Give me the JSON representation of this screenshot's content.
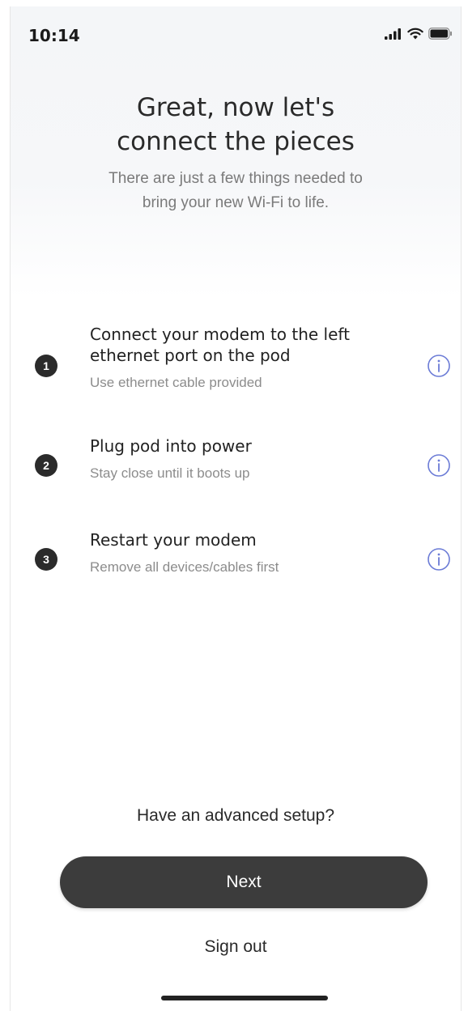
{
  "status_bar": {
    "time": "10:14",
    "icons": [
      "signal-icon",
      "wifi-icon",
      "battery-icon"
    ]
  },
  "header": {
    "title_line1": "Great, now let's",
    "title_line2": "connect the pieces",
    "subtitle_line1": "There are just a few things needed to",
    "subtitle_line2": "bring your new Wi-Fi to life."
  },
  "steps": [
    {
      "number": "1",
      "title_line1": "Connect your modem to the left",
      "title_line2": "ethernet port on the pod",
      "description": "Use ethernet cable provided",
      "icon": "info-icon"
    },
    {
      "number": "2",
      "title_line1": "Plug pod into power",
      "description": "Stay close until it boots up",
      "icon": "info-icon"
    },
    {
      "number": "3",
      "title_line1": "Restart your modem",
      "description": "Remove all devices/cables first",
      "icon": "info-icon"
    }
  ],
  "footer": {
    "advanced_link": "Have an advanced setup?",
    "next_label": "Next",
    "sign_out_label": "Sign out"
  },
  "colors": {
    "accent": "#6b7bd6",
    "button_bg": "#3c3c3c",
    "step_badge": "#2b2b2b"
  }
}
